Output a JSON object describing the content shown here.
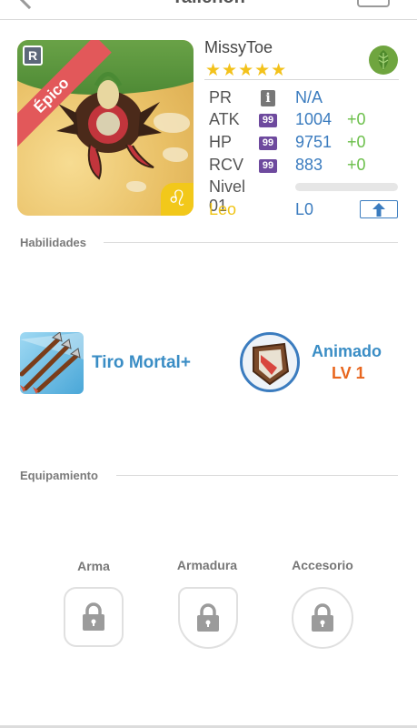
{
  "header": {
    "title": "Tallehon",
    "back_icon": "chevron-left-icon",
    "menu_icon": "eye-icon"
  },
  "hero": {
    "name": "MissyToe",
    "stars": "★★★★★",
    "star_count": 5,
    "rarity": "Épico",
    "rarity_badge": "R",
    "zodiac_glyph": "♌",
    "element_icon": "leaf-icon",
    "element_color": "#6fa53f"
  },
  "stats": {
    "pr": {
      "label": "PR",
      "value": "N/A"
    },
    "atk": {
      "label": "ATK",
      "badge": "99",
      "value": "1004",
      "bonus": "+0"
    },
    "hp": {
      "label": "HP",
      "badge": "99",
      "value": "9751",
      "bonus": "+0"
    },
    "rcv": {
      "label": "RCV",
      "badge": "99",
      "value": "883",
      "bonus": "+0"
    },
    "level": {
      "label": "Nivel 01",
      "progress": 0
    },
    "sign": "Leo",
    "lp": "L0"
  },
  "abilities": {
    "title": "Habilidades",
    "skill_name": "Tiro Mortal+",
    "skill_icon": "arrows-skill-icon",
    "passive_name": "Animado",
    "passive_level": "LV 1",
    "passive_icon": "shield-emblem-icon"
  },
  "equipment": {
    "title": "Equipamiento",
    "slots": [
      {
        "label": "Arma"
      },
      {
        "label": "Armadura"
      },
      {
        "label": "Accesorio"
      }
    ]
  },
  "colors": {
    "accent_blue": "#3b7cbf",
    "bonus_green": "#6bbf4a",
    "star_yellow": "#f3c21b",
    "level_orange": "#e8661e",
    "ribbon_red": "#e2585a"
  }
}
